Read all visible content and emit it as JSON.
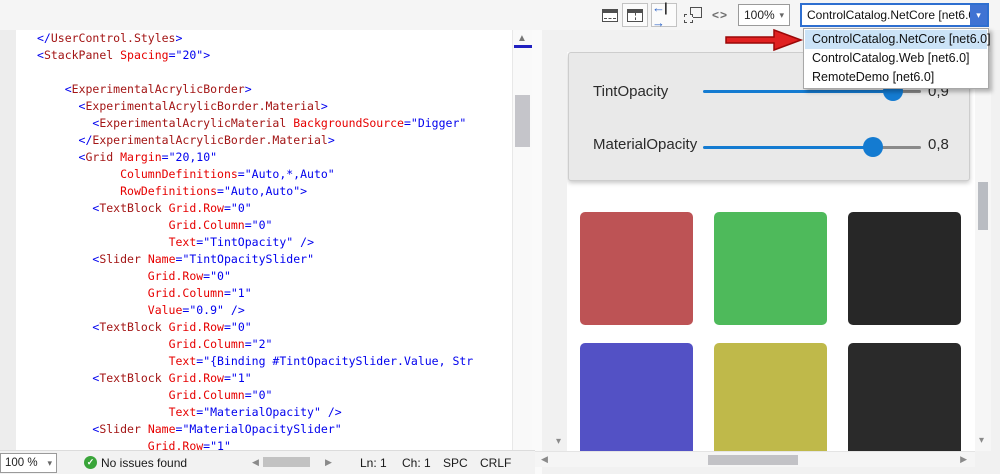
{
  "colors": {
    "accent_blue": "#2e6fd0",
    "combo_button_blue": "#3f73d3",
    "selected_item_bg": "#cbe3f7",
    "arrow_red": "#e02020",
    "arrow_red_dark": "#9b0707",
    "slider_blue": "#147bd1",
    "slider_gray": "#8a8a8a",
    "ok_green": "#3aa53a",
    "swatches": [
      "#bd5355",
      "#4eba5b",
      "#272727",
      "#5351c5",
      "#bfb94a",
      "#2a2a2a"
    ]
  },
  "toolbar": {
    "zoom_value": "100%",
    "project_combobox_value": "ControlCatalog.NetCore [net6.0]",
    "icons": [
      "split-horizontal",
      "split-vertical",
      "swap-panes",
      "float-window",
      "code-view"
    ],
    "code_view_glyph": "<>"
  },
  "dropdown": {
    "items": [
      {
        "label": "ControlCatalog.NetCore [net6.0]",
        "selected": true
      },
      {
        "label": "ControlCatalog.Web [net6.0]",
        "selected": false
      },
      {
        "label": "RemoteDemo [net6.0]",
        "selected": false
      }
    ]
  },
  "editor": {
    "code_lines": [
      [
        [
          "d",
          "</"
        ],
        [
          "e",
          "UserControl.Styles"
        ],
        [
          "d",
          ">"
        ]
      ],
      [
        [
          "d",
          "<"
        ],
        [
          "e",
          "StackPanel"
        ],
        [
          "t",
          " "
        ],
        [
          "a",
          "Spacing"
        ],
        [
          "v",
          "=\"20\""
        ],
        [
          "d",
          ">"
        ]
      ],
      [],
      [
        [
          "t",
          "    "
        ],
        [
          "d",
          "<"
        ],
        [
          "e",
          "ExperimentalAcrylicBorder"
        ],
        [
          "d",
          ">"
        ]
      ],
      [
        [
          "t",
          "      "
        ],
        [
          "d",
          "<"
        ],
        [
          "e",
          "ExperimentalAcrylicBorder.Material"
        ],
        [
          "d",
          ">"
        ]
      ],
      [
        [
          "t",
          "        "
        ],
        [
          "d",
          "<"
        ],
        [
          "e",
          "ExperimentalAcrylicMaterial"
        ],
        [
          "t",
          " "
        ],
        [
          "a",
          "BackgroundSource"
        ],
        [
          "v",
          "=\"Digger\""
        ]
      ],
      [
        [
          "t",
          "      "
        ],
        [
          "d",
          "</"
        ],
        [
          "e",
          "ExperimentalAcrylicBorder.Material"
        ],
        [
          "d",
          ">"
        ]
      ],
      [
        [
          "t",
          "      "
        ],
        [
          "d",
          "<"
        ],
        [
          "e",
          "Grid"
        ],
        [
          "t",
          " "
        ],
        [
          "a",
          "Margin"
        ],
        [
          "v",
          "=\"20,10\""
        ]
      ],
      [
        [
          "t",
          "            "
        ],
        [
          "a",
          "ColumnDefinitions"
        ],
        [
          "v",
          "=\"Auto,*,Auto\""
        ]
      ],
      [
        [
          "t",
          "            "
        ],
        [
          "a",
          "RowDefinitions"
        ],
        [
          "v",
          "=\"Auto,Auto\""
        ],
        [
          "d",
          ">"
        ]
      ],
      [
        [
          "t",
          "        "
        ],
        [
          "d",
          "<"
        ],
        [
          "e",
          "TextBlock"
        ],
        [
          "t",
          " "
        ],
        [
          "a",
          "Grid.Row"
        ],
        [
          "v",
          "=\"0\""
        ]
      ],
      [
        [
          "t",
          "                   "
        ],
        [
          "a",
          "Grid.Column"
        ],
        [
          "v",
          "=\"0\""
        ]
      ],
      [
        [
          "t",
          "                   "
        ],
        [
          "a",
          "Text"
        ],
        [
          "v",
          "=\"TintOpacity\""
        ],
        [
          "t",
          " "
        ],
        [
          "d",
          "/>"
        ]
      ],
      [
        [
          "t",
          "        "
        ],
        [
          "d",
          "<"
        ],
        [
          "e",
          "Slider"
        ],
        [
          "t",
          " "
        ],
        [
          "a",
          "Name"
        ],
        [
          "v",
          "=\"TintOpacitySlider\""
        ]
      ],
      [
        [
          "t",
          "                "
        ],
        [
          "a",
          "Grid.Row"
        ],
        [
          "v",
          "=\"0\""
        ]
      ],
      [
        [
          "t",
          "                "
        ],
        [
          "a",
          "Grid.Column"
        ],
        [
          "v",
          "=\"1\""
        ]
      ],
      [
        [
          "t",
          "                "
        ],
        [
          "a",
          "Value"
        ],
        [
          "v",
          "=\"0.9\""
        ],
        [
          "t",
          " "
        ],
        [
          "d",
          "/>"
        ]
      ],
      [
        [
          "t",
          "        "
        ],
        [
          "d",
          "<"
        ],
        [
          "e",
          "TextBlock"
        ],
        [
          "t",
          " "
        ],
        [
          "a",
          "Grid.Row"
        ],
        [
          "v",
          "=\"0\""
        ]
      ],
      [
        [
          "t",
          "                   "
        ],
        [
          "a",
          "Grid.Column"
        ],
        [
          "v",
          "=\"2\""
        ]
      ],
      [
        [
          "t",
          "                   "
        ],
        [
          "a",
          "Text"
        ],
        [
          "v",
          "=\"{Binding #TintOpacitySlider.Value, Str"
        ]
      ],
      [
        [
          "t",
          "        "
        ],
        [
          "d",
          "<"
        ],
        [
          "e",
          "TextBlock"
        ],
        [
          "t",
          " "
        ],
        [
          "a",
          "Grid.Row"
        ],
        [
          "v",
          "=\"1\""
        ]
      ],
      [
        [
          "t",
          "                   "
        ],
        [
          "a",
          "Grid.Column"
        ],
        [
          "v",
          "=\"0\""
        ]
      ],
      [
        [
          "t",
          "                   "
        ],
        [
          "a",
          "Text"
        ],
        [
          "v",
          "=\"MaterialOpacity\""
        ],
        [
          "t",
          " "
        ],
        [
          "d",
          "/>"
        ]
      ],
      [
        [
          "t",
          "        "
        ],
        [
          "d",
          "<"
        ],
        [
          "e",
          "Slider"
        ],
        [
          "t",
          " "
        ],
        [
          "a",
          "Name"
        ],
        [
          "v",
          "=\"MaterialOpacitySlider\""
        ]
      ],
      [
        [
          "t",
          "                "
        ],
        [
          "a",
          "Grid.Row"
        ],
        [
          "v",
          "=\"1\""
        ]
      ]
    ]
  },
  "statusbar": {
    "zoom_value": "100 %",
    "issues_text": "No issues found",
    "line": "Ln: 1",
    "column": "Ch: 1",
    "spaces": "SPC",
    "line_ending": "CRLF"
  },
  "preview": {
    "sliders": [
      {
        "label": "TintOpacity",
        "value_text": "0,9",
        "fraction": 0.87
      },
      {
        "label": "MaterialOpacity",
        "value_text": "0,8",
        "fraction": 0.78
      }
    ]
  }
}
